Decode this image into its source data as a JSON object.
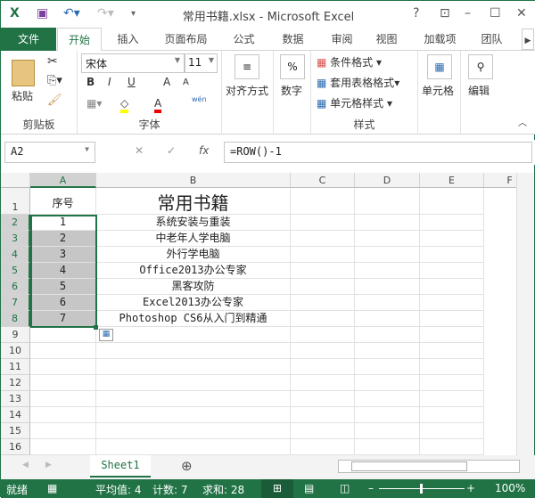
{
  "title": "常用书籍.xlsx - Microsoft Excel",
  "tabs": [
    "文件",
    "开始",
    "插入",
    "页面布局",
    "公式",
    "数据",
    "审阅",
    "视图",
    "加载项",
    "团队"
  ],
  "ribbon": {
    "clipboard": {
      "paste": "粘贴",
      "label": "剪贴板"
    },
    "font": {
      "name": "宋体",
      "size": "11",
      "label": "字体",
      "bold": "B",
      "italic": "I",
      "underline": "U",
      "grow": "A",
      "shrink": "A",
      "font_color": "A",
      "phonetic": "wén"
    },
    "alignment": "对齐方式",
    "number": "数字",
    "number_icon": "%",
    "styles": {
      "cond": "条件格式",
      "table": "套用表格格式",
      "cell": "单元格样式",
      "label": "样式"
    },
    "cells": "单元格",
    "editing": "编辑"
  },
  "formula_bar": {
    "name_box": "A2",
    "formula": "=ROW()-1",
    "fx": "fx"
  },
  "columns": [
    "A",
    "B",
    "C",
    "D",
    "E",
    "F"
  ],
  "rows": [
    "1",
    "2",
    "3",
    "4",
    "5",
    "6",
    "7",
    "8",
    "9",
    "10",
    "11",
    "12",
    "13",
    "14",
    "15",
    "16"
  ],
  "cells": {
    "A": [
      "序号",
      "1",
      "2",
      "3",
      "4",
      "5",
      "6",
      "7"
    ],
    "B": [
      "常用书籍",
      "系统安装与重装",
      "中老年人学电脑",
      "外行学电脑",
      "Office2013办公专家",
      "黑客攻防",
      "Excel2013办公专家",
      "Photoshop CS6从入门到精通"
    ]
  },
  "sheet_tab": "Sheet1",
  "status": {
    "ready": "就绪",
    "average": "平均值: 4",
    "count": "计数: 7",
    "sum": "求和: 28",
    "zoom": "100%"
  },
  "colors": {
    "accent": "#217346",
    "selection": "#c6c6c6"
  }
}
